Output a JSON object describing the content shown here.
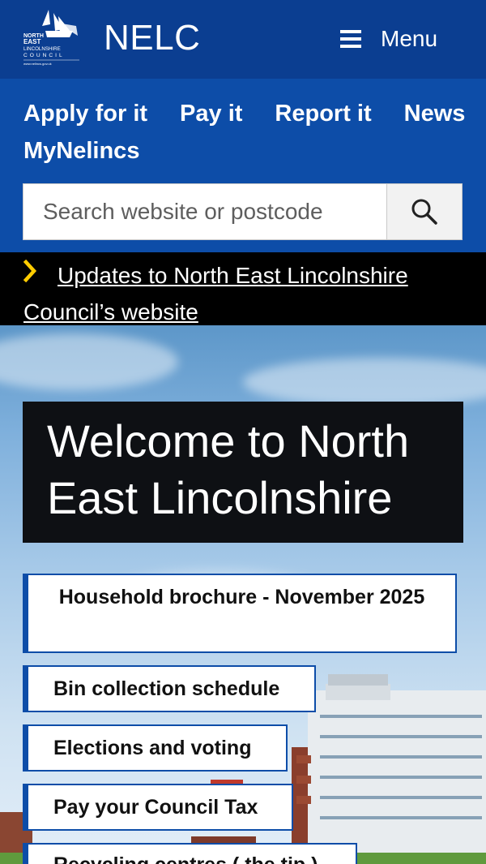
{
  "header": {
    "logo_text": "NORTH EAST LINCOLNSHIRE COUNCIL",
    "site_title": "NELC",
    "menu_label": "Menu"
  },
  "quick_links": [
    "Apply for it",
    "Pay it",
    "Report it",
    "News",
    "MyNelincs"
  ],
  "search": {
    "placeholder": "Search website or postcode",
    "value": ""
  },
  "notice": {
    "text": "Updates to North East Lincolnshire Council’s website"
  },
  "hero": {
    "title": "Welcome to North East Lincolnshire",
    "buttons": [
      "Household brochure - November 2025",
      "Bin collection schedule",
      "Elections and voting",
      "Pay your Council Tax",
      "Recycling centres ( the tip )"
    ]
  },
  "colors": {
    "header": "#0b3e91",
    "quickbar": "#0d4da8",
    "notice_bg": "#000000",
    "chevron": "#ffcc00",
    "hero_box": "#0e1014"
  },
  "icons": {
    "menu": "hamburger-icon",
    "search": "magnifier-icon",
    "notice": "chevron-right-icon"
  }
}
